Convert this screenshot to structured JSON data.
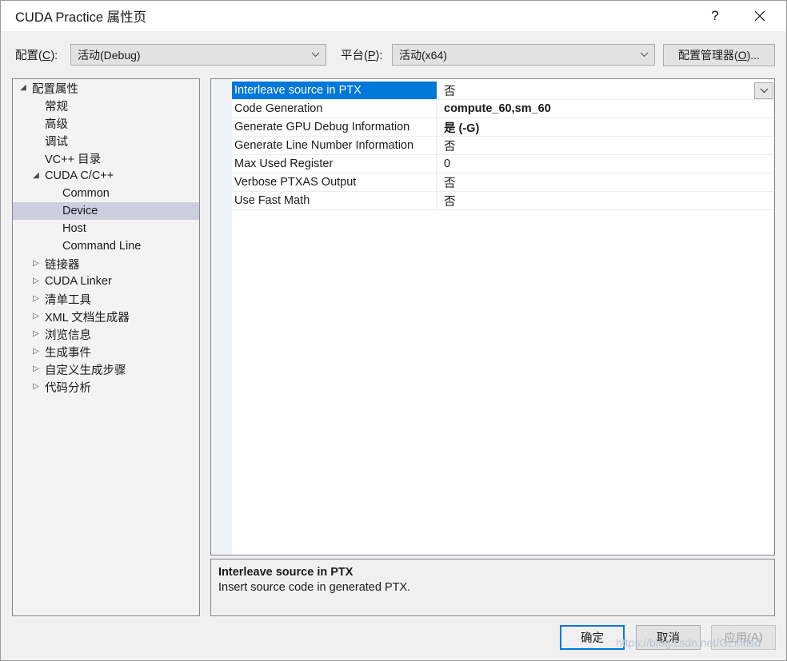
{
  "window": {
    "title": "CUDA Practice 属性页",
    "help_icon": "?",
    "close_icon": "close-icon"
  },
  "config_bar": {
    "config_label": "配置(C):",
    "config_label_prefix": "配置(",
    "config_label_accel": "C",
    "config_label_suffix": "):",
    "config_value": "活动(Debug)",
    "platform_label_prefix": "平台(",
    "platform_label_accel": "P",
    "platform_label_suffix": "):",
    "platform_value": "活动(x64)",
    "config_manager_prefix": "配置管理器(",
    "config_manager_accel": "O",
    "config_manager_suffix": ")...",
    "dropdown_icon": "chevron-down-icon"
  },
  "tree": {
    "items": [
      {
        "label": "配置属性",
        "indent": 0,
        "expander": "expanded",
        "selected": false
      },
      {
        "label": "常规",
        "indent": 1,
        "expander": "none",
        "selected": false
      },
      {
        "label": "高级",
        "indent": 1,
        "expander": "none",
        "selected": false
      },
      {
        "label": "调试",
        "indent": 1,
        "expander": "none",
        "selected": false
      },
      {
        "label": "VC++ 目录",
        "indent": 1,
        "expander": "none",
        "selected": false
      },
      {
        "label": "CUDA C/C++",
        "indent": 1,
        "expander": "expanded",
        "selected": false
      },
      {
        "label": "Common",
        "indent": 2,
        "expander": "none",
        "selected": false
      },
      {
        "label": "Device",
        "indent": 2,
        "expander": "none",
        "selected": true
      },
      {
        "label": "Host",
        "indent": 2,
        "expander": "none",
        "selected": false
      },
      {
        "label": "Command Line",
        "indent": 2,
        "expander": "none",
        "selected": false
      },
      {
        "label": "链接器",
        "indent": 1,
        "expander": "collapsed",
        "selected": false
      },
      {
        "label": "CUDA Linker",
        "indent": 1,
        "expander": "collapsed",
        "selected": false
      },
      {
        "label": "清单工具",
        "indent": 1,
        "expander": "collapsed",
        "selected": false
      },
      {
        "label": "XML 文档生成器",
        "indent": 1,
        "expander": "collapsed",
        "selected": false
      },
      {
        "label": "浏览信息",
        "indent": 1,
        "expander": "collapsed",
        "selected": false
      },
      {
        "label": "生成事件",
        "indent": 1,
        "expander": "collapsed",
        "selected": false
      },
      {
        "label": "自定义生成步骤",
        "indent": 1,
        "expander": "collapsed",
        "selected": false
      },
      {
        "label": "代码分析",
        "indent": 1,
        "expander": "collapsed",
        "selected": false
      }
    ]
  },
  "property_grid": {
    "rows": [
      {
        "name": "Interleave source in PTX",
        "value": "否",
        "selected": true,
        "bold": false,
        "has_dropdown": true
      },
      {
        "name": "Code Generation",
        "value": "compute_60,sm_60",
        "selected": false,
        "bold": true,
        "has_dropdown": false
      },
      {
        "name": "Generate GPU Debug Information",
        "value": "是 (-G)",
        "selected": false,
        "bold": true,
        "has_dropdown": false
      },
      {
        "name": "Generate Line Number Information",
        "value": "否",
        "selected": false,
        "bold": false,
        "has_dropdown": false
      },
      {
        "name": "Max Used Register",
        "value": "0",
        "selected": false,
        "bold": false,
        "has_dropdown": false
      },
      {
        "name": "Verbose PTXAS Output",
        "value": "否",
        "selected": false,
        "bold": false,
        "has_dropdown": false
      },
      {
        "name": "Use Fast Math",
        "value": "否",
        "selected": false,
        "bold": false,
        "has_dropdown": false
      }
    ]
  },
  "description": {
    "title": "Interleave source in PTX",
    "body": "Insert source code in generated PTX."
  },
  "footer": {
    "ok_label": "确定",
    "cancel_label": "取消",
    "apply_prefix": "应用(",
    "apply_accel": "A",
    "apply_suffix": ")"
  },
  "watermark": {
    "text": "https://blog.csdn.net/GLinttsd"
  },
  "colors": {
    "selection_blue": "#0078d7",
    "tree_selection": "#cdcfdf",
    "dialog_background": "#f0f0f0",
    "grid_gutter": "#eff3f7"
  }
}
